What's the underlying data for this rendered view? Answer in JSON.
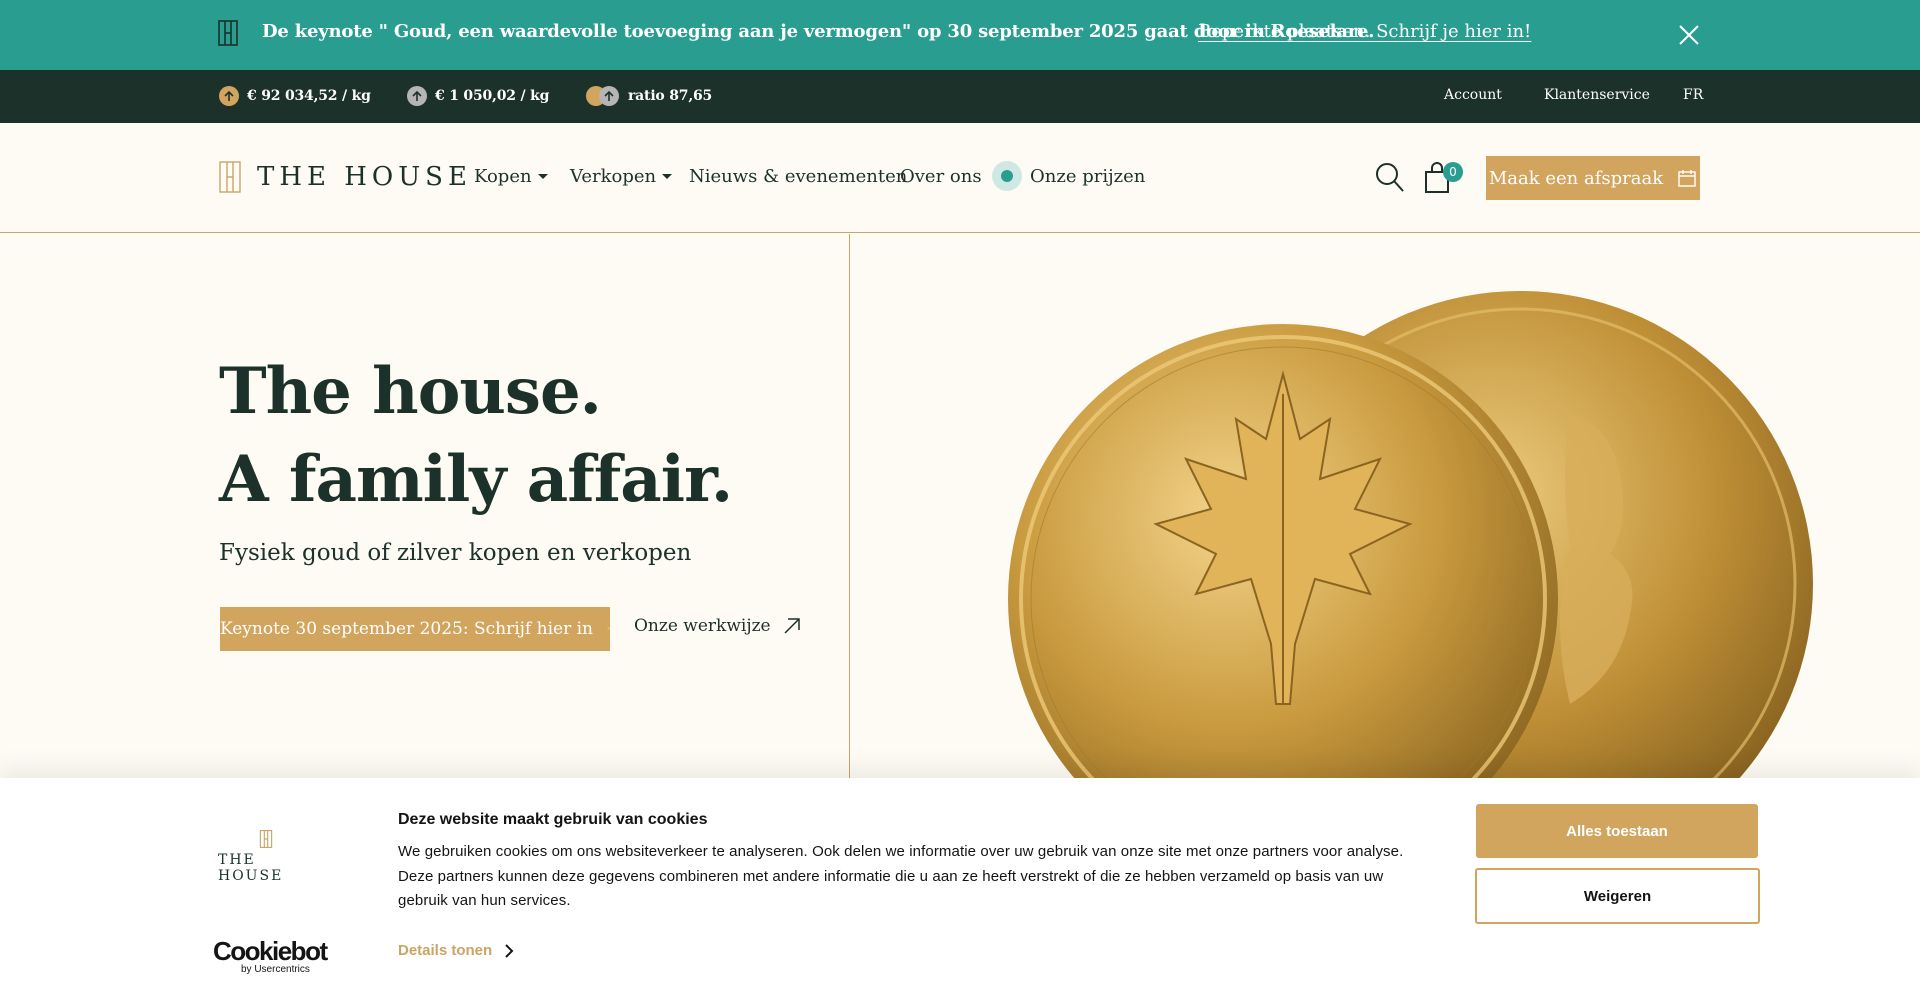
{
  "announcement": {
    "text": "De keynote \" Goud, een waardevolle toevoeging aan je vermogen\" op 30 september 2025 gaat door in Roeselare.",
    "link": "Beperkte plaatsen. Schrijf je hier in!",
    "icon": "logo-mark-icon",
    "close_icon": "close-icon"
  },
  "pricebar": {
    "gold_price": "€ 92 034,52 / kg",
    "silver_price": "€ 1 050,02 / kg",
    "ratio": "ratio 87,65",
    "gold_trend": "up",
    "silver_trend": "up",
    "links": [
      "Account",
      "Klantenservice",
      "FR"
    ]
  },
  "nav": {
    "logo_text": "THE HOUSE",
    "items": [
      {
        "label": "Kopen",
        "dropdown": true
      },
      {
        "label": "Verkopen",
        "dropdown": true
      },
      {
        "label": "Nieuws & evenementen",
        "dropdown": false
      },
      {
        "label": "Over ons",
        "dropdown": false
      },
      {
        "label": "Onze prijzen",
        "dropdown": false
      }
    ],
    "cart_count": "0",
    "appointment_label": "Maak een afspraak"
  },
  "hero": {
    "title_line1": "The house.",
    "title_line2": "A family affair.",
    "subtitle": "Fysiek goud of zilver kopen en verkopen",
    "cta_primary": "Keynote 30 september 2025: Schrijf hier in",
    "cta_secondary": "Onze werkwijze",
    "image": "gold-maple-leaf-coins"
  },
  "cookie": {
    "logo_text": "THE HOUSE",
    "title": "Deze website maakt gebruik van cookies",
    "body": "We gebruiken cookies om ons websiteverkeer te analyseren. Ook delen we informatie over uw gebruik van onze site met onze partners voor analyse. Deze partners kunnen deze gegevens combineren met andere informatie die u aan ze heeft verstrekt of die ze hebben verzameld op basis van uw gebruik van hun services.",
    "details": "Details tonen",
    "accept": "Alles toestaan",
    "reject": "Weigeren",
    "provider": "Cookiebot",
    "provider_by": "by Usercentrics"
  },
  "colors": {
    "teal": "#2a9d91",
    "dark_green": "#1c3129",
    "gold": "#d2a55f",
    "cream": "#fdfbf4"
  }
}
